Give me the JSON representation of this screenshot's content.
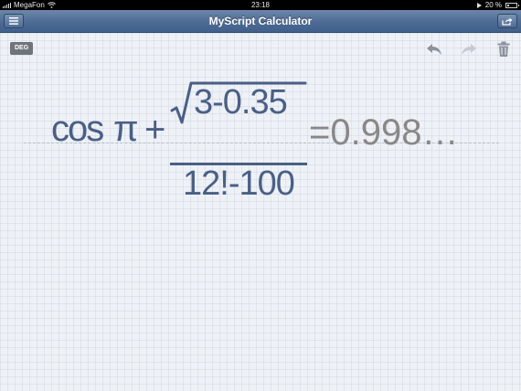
{
  "status_bar": {
    "carrier": "MegaFon",
    "time": "23:18",
    "battery_text": "20 %"
  },
  "nav": {
    "title": "MyScript Calculator",
    "menu_icon": "menu-icon",
    "share_icon": "share-icon"
  },
  "toolbar": {
    "angle_mode": "DEG",
    "undo_icon": "undo-icon",
    "redo_icon": "redo-icon",
    "trash_icon": "trash-icon"
  },
  "expression": {
    "function": "cos",
    "constant": "π",
    "operator": "+",
    "numerator": "3-0.35",
    "denominator": "12!-100",
    "result": "=0.998…"
  },
  "colors": {
    "ink": "#4a5f86",
    "result": "#888888",
    "nav_bar": "#4d6b94",
    "redo_disabled": "#c4cad3"
  }
}
